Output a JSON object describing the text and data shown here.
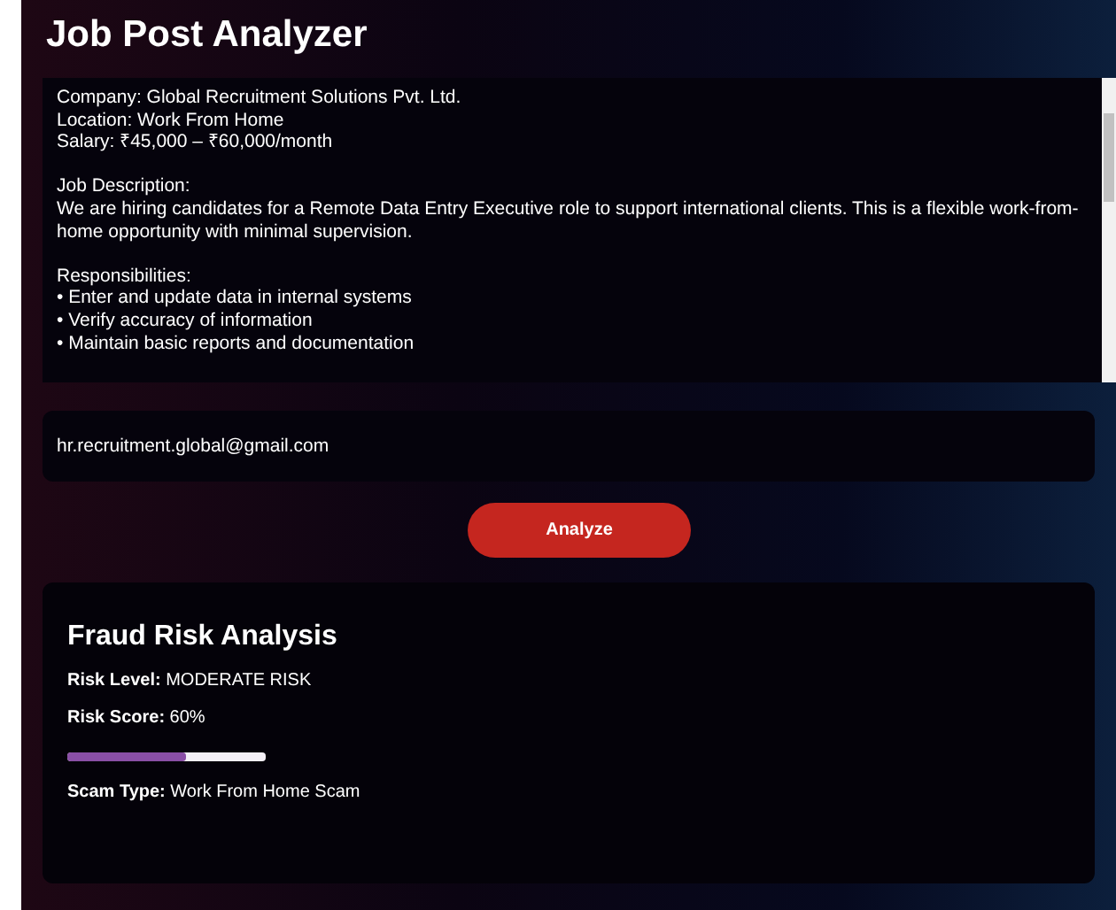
{
  "title": "Job Post Analyzer",
  "job_post": {
    "value": "Company: Global Recruitment Solutions Pvt. Ltd.\nLocation: Work From Home\nSalary: ₹45,000 – ₹60,000/month\n\nJob Description:\nWe are hiring candidates for a Remote Data Entry Executive role to support international clients. This is a flexible work-from-home opportunity with minimal supervision.\n\nResponsibilities:\n• Enter and update data in internal systems\n• Verify accuracy of information\n• Maintain basic reports and documentation"
  },
  "email": {
    "value": "hr.recruitment.global@gmail.com"
  },
  "analyze_button": "Analyze",
  "result": {
    "title": "Fraud Risk Analysis",
    "lines": [
      {
        "text": "**Risk Level:** MODERATE RISK"
      },
      {
        "text": "**Risk Score:** 60%"
      }
    ],
    "risk_bar": {
      "level": 0.6
    },
    "scam_type": "**Scam Type:** Work From Home Scam"
  }
}
